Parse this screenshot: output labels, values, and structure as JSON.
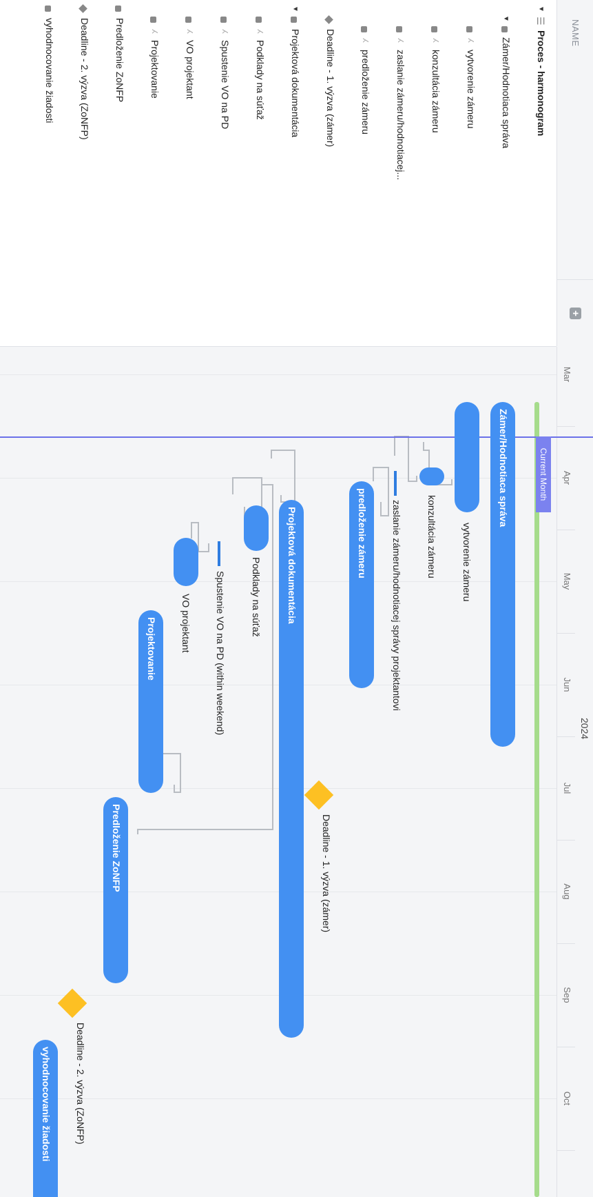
{
  "header": {
    "name_col": "NAME",
    "add_icon": "plus-icon",
    "year": "2024",
    "months": [
      "Mar",
      "Apr",
      "May",
      "Jun",
      "Jul",
      "Aug",
      "Sep",
      "Oct"
    ]
  },
  "current_month": {
    "label": "Current Month",
    "color": "#6b70e8"
  },
  "tree": [
    {
      "label": "Proces - harmonogram",
      "type": "project",
      "bold": true
    },
    {
      "label": "Zámer/Hodnotiaca správa",
      "type": "group"
    },
    {
      "label": "vytvorenie zámeru",
      "type": "task"
    },
    {
      "label": "konzultácia zámeru",
      "type": "task"
    },
    {
      "label": "zaslanie zámeru/hodnotiacej...",
      "type": "task"
    },
    {
      "label": "predloženie zámeru",
      "type": "task"
    },
    {
      "label": "Deadline - 1. výzva (zámer)",
      "type": "milestone"
    },
    {
      "label": "Projektová dokumentácia",
      "type": "group"
    },
    {
      "label": "Podklady na súťaž",
      "type": "task"
    },
    {
      "label": "Spustenie VO na PD",
      "type": "task"
    },
    {
      "label": "VO projektant",
      "type": "task"
    },
    {
      "label": "Projektovanie",
      "type": "task"
    },
    {
      "label": "Predloženie ZoNFP",
      "type": "task"
    },
    {
      "label": "Deadline - 2. výzva (ZoNFP)",
      "type": "milestone"
    },
    {
      "label": "vyhodnocovanie žiadosti",
      "type": "task"
    }
  ],
  "gantt": {
    "bar_color": "#4390f2",
    "milestone_color": "#fdc023",
    "items": [
      {
        "name": "Zámer/Hodnotiaca správa",
        "inside_label": "Zámer/Hodnotiaca správa"
      },
      {
        "name": "vytvorenie zámeru",
        "label": "vytvorenie zámeru"
      },
      {
        "name": "konzultácia zámeru",
        "label": "konzultácia zámeru"
      },
      {
        "name": "zaslanie",
        "label": "zaslanie zámeru/hodnotiacej správy projektantovi"
      },
      {
        "name": "predloženie zámeru",
        "inside_label": "predloženie zámeru"
      },
      {
        "name": "Deadline 1",
        "label": "Deadline - 1. výzva (zámer)"
      },
      {
        "name": "Projektová dokumentácia",
        "inside_label": "Projektová dokumentácia"
      },
      {
        "name": "Podklady",
        "label": "Podklady na súťaž"
      },
      {
        "name": "Spustenie",
        "label": "Spustenie VO na PD (within weekend)"
      },
      {
        "name": "VO projektant",
        "label": "VO projektant"
      },
      {
        "name": "Projektovanie",
        "inside_label": "Projektovanie"
      },
      {
        "name": "Predloženie ZoNFP",
        "inside_label": "Predloženie ZoNFP"
      },
      {
        "name": "Deadline 2",
        "label": "Deadline - 2. výzva (ZoNFP)"
      },
      {
        "name": "vyhodnocovanie",
        "inside_label": "vyhodnocovanie žiadosti"
      }
    ]
  }
}
